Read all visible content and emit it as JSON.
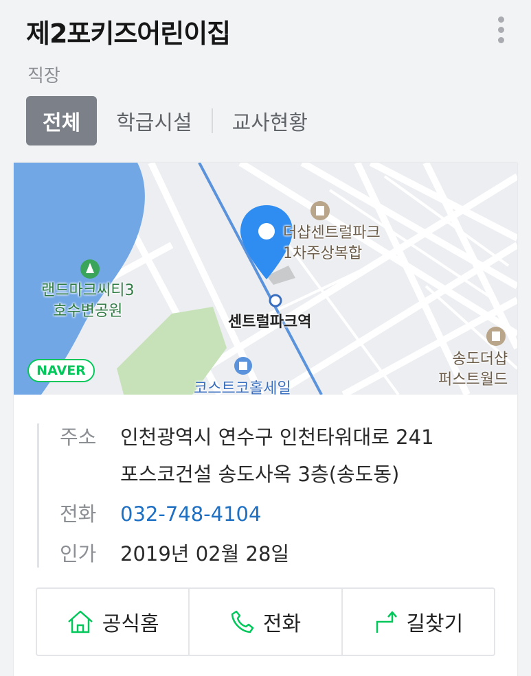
{
  "header": {
    "title": "제2포키즈어린이집",
    "subtitle": "직장",
    "more_icon": "more-vertical-icon"
  },
  "tabs": [
    {
      "label": "전체",
      "active": true
    },
    {
      "label": "학급시설",
      "active": false
    },
    {
      "label": "교사현황",
      "active": false
    }
  ],
  "map": {
    "brand": "NAVER",
    "labels": {
      "park": "랜드마크씨티3\n호수변공원",
      "building": "더샵센트럴파크\n1차주상복합",
      "station": "센트럴파크역",
      "bottom": "코스트코홀세일",
      "right": "송도더샵\n퍼스트월드"
    }
  },
  "info": {
    "address_label": "주소",
    "address_line1": "인천광역시 연수구 인천타워대로 241",
    "address_line2": "포스코건설 송도사옥 3층(송도동)",
    "phone_label": "전화",
    "phone": "032-748-4104",
    "license_label": "인가",
    "license_date": "2019년 02월 28일"
  },
  "actions": {
    "homepage": "공식홈",
    "call": "전화",
    "directions": "길찾기"
  },
  "colors": {
    "accent_green": "#03c75a",
    "link_blue": "#1f6fc2",
    "tab_active_bg": "#7b8089",
    "map_pin": "#2f8cf0",
    "water": "#72a7e6"
  }
}
